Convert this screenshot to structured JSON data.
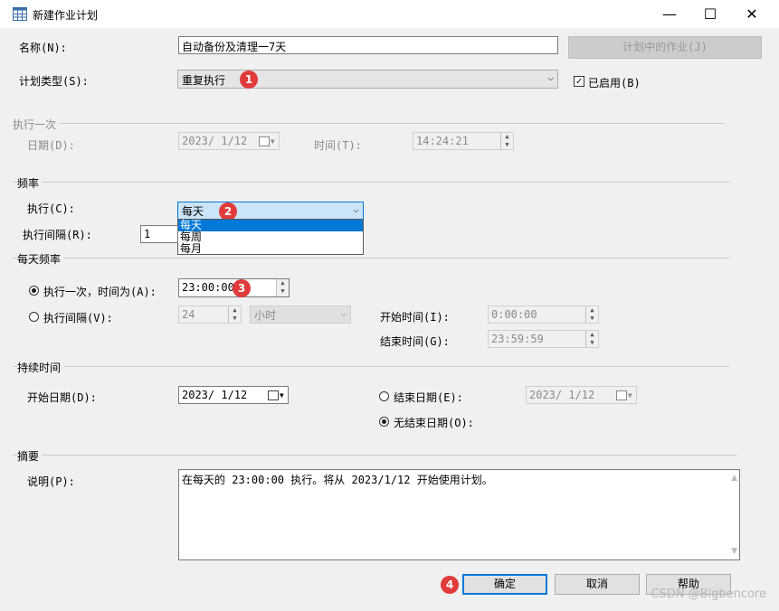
{
  "window": {
    "title": "新建作业计划",
    "minimize": "—",
    "maximize": "☐",
    "close": "✕"
  },
  "name": {
    "label": "名称(N):",
    "value": "自动备份及清理一7天",
    "jobs_button": "计划中的作业(J)"
  },
  "schedule_type": {
    "label": "计划类型(S):",
    "value": "重复执行",
    "enabled_label": "已启用(B)",
    "enabled": true
  },
  "one_time": {
    "group": "执行一次",
    "date_label": "日期(D):",
    "date": "2023/ 1/12",
    "time_label": "时间(T):",
    "time": "14:24:21"
  },
  "frequency": {
    "group": "频率",
    "occurs_label": "执行(C):",
    "occurs_value": "每天",
    "interval_label": "执行间隔(R):",
    "interval_value": "1",
    "options": [
      "每天",
      "每周",
      "每月"
    ]
  },
  "daily": {
    "group": "每天频率",
    "once_label": "执行一次，时间为(A):",
    "once_time": "23:00:00",
    "every_label": "执行间隔(V):",
    "every_value": "24",
    "every_unit": "小时",
    "start_label": "开始时间(I):",
    "start_time": "0:00:00",
    "end_label": "结束时间(G):",
    "end_time": "23:59:59"
  },
  "duration": {
    "group": "持续时间",
    "start_label": "开始日期(D):",
    "start_date": "2023/ 1/12",
    "end_label": "结束日期(E):",
    "end_date": "2023/ 1/12",
    "no_end_label": "无结束日期(O):"
  },
  "summary": {
    "group": "摘要",
    "desc_label": "说明(P):",
    "text": "在每天的 23:00:00 执行。将从 2023/1/12 开始使用计划。"
  },
  "buttons": {
    "ok": "确定",
    "cancel": "取消",
    "help": "帮助"
  },
  "badges": [
    "1",
    "2",
    "3",
    "4"
  ],
  "watermark": "CSDN @Bigbencore",
  "colors": {
    "accent": "#0078d7",
    "badge": "#e03a3a"
  }
}
